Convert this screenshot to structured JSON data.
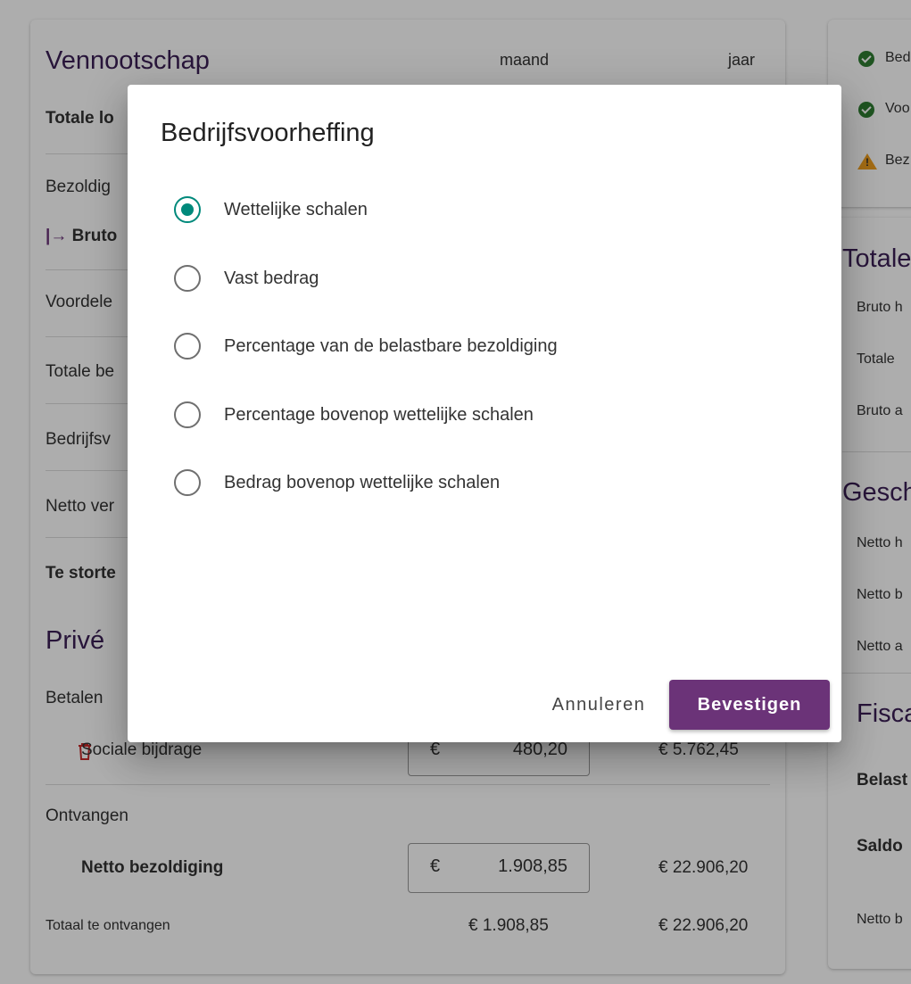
{
  "left": {
    "title": "Vennootschap",
    "col_month": "maand",
    "col_year": "jaar",
    "rows": [
      "Totale lo",
      "Bezoldig",
      "Bruto",
      "Voordele",
      "Totale be",
      "Bedrijfsv",
      "Netto ver",
      "Te storte"
    ],
    "bruto_arrow": "|→",
    "prive_title": "Privé",
    "betalen_label": "Betalen",
    "sociale_label": "Sociale bijdrage",
    "sociale_currency": "€",
    "sociale_month": "480,20",
    "sociale_year": "€ 5.762,45",
    "ontvangen_label": "Ontvangen",
    "netto_label": "Netto bezoldiging",
    "netto_currency": "€",
    "netto_month": "1.908,85",
    "netto_year": "€ 22.906,20",
    "totaal_label": "Totaal te ontvangen",
    "totaal_month": "€ 1.908,85",
    "totaal_year": "€ 22.906,20"
  },
  "right_top": {
    "items": [
      {
        "icon": "check-circle-icon",
        "label": "Bed"
      },
      {
        "icon": "check-circle-icon",
        "label": "Voo"
      },
      {
        "icon": "warning-icon",
        "label": "Bez"
      }
    ]
  },
  "right_main": {
    "totale_title": "Totale",
    "totale_rows": [
      "Bruto h",
      "Totale",
      "Bruto a"
    ],
    "gesch_title": "Gesch",
    "gesch_rows": [
      "Netto h",
      "Netto b",
      "Netto a"
    ],
    "fisc_title": "Fisca",
    "belast": "Belast",
    "saldo": "Saldo",
    "netto_b": "Netto b"
  },
  "dialog": {
    "title": "Bedrijfsvoorheffing",
    "options": [
      {
        "label": "Wettelijke schalen",
        "selected": true
      },
      {
        "label": "Vast bedrag",
        "selected": false
      },
      {
        "label": "Percentage van de belastbare bezoldiging",
        "selected": false
      },
      {
        "label": "Percentage bovenop wettelijke schalen",
        "selected": false
      },
      {
        "label": "Bedrag bovenop wettelijke schalen",
        "selected": false
      }
    ],
    "cancel_label": "Annuleren",
    "confirm_label": "Bevestigen"
  },
  "colors": {
    "accent_teal": "#00897b",
    "primary_purple": "#6b3378",
    "title_purple": "#3b1f56"
  }
}
